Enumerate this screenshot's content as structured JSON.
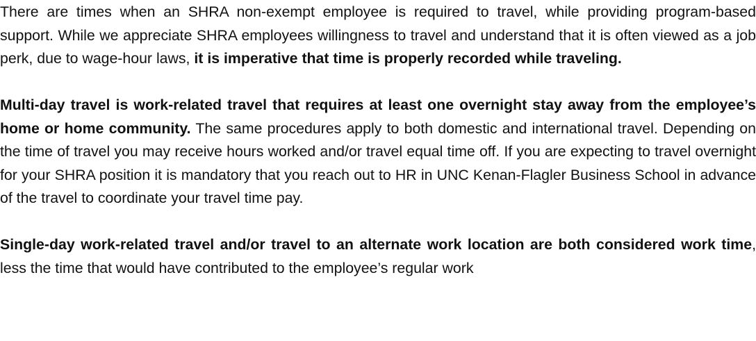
{
  "document": {
    "p1": {
      "text": "There are times when an SHRA non-exempt employee is required to travel, while providing program-based support. While we appreciate SHRA employees willingness to travel and un­derstand that it is often viewed as a job perk, due to wage-hour laws, ",
      "bold": "it is imperative that time is properly recorded while traveling."
    },
    "p2": {
      "bold": "Multi-day travel is work-related travel that requires at least one overnight stay away from the employee’s home or home community.",
      "text": " The same procedures apply to both domestic and in­ternational travel. Depending on the time of travel you may receive hours worked and/or travel equal time off. If you are expecting to travel overnight for your SHRA position it is mandatory that you reach out to HR in UNC Kenan-Flagler Business School in advance of the travel to coordinate your travel time pay."
    },
    "p3": {
      "bold": "Single-day work-related travel and/or travel to an alternate work location are both consid­ered work time",
      "text": ", less the time that would have contributed to the employee’s regular work"
    }
  }
}
